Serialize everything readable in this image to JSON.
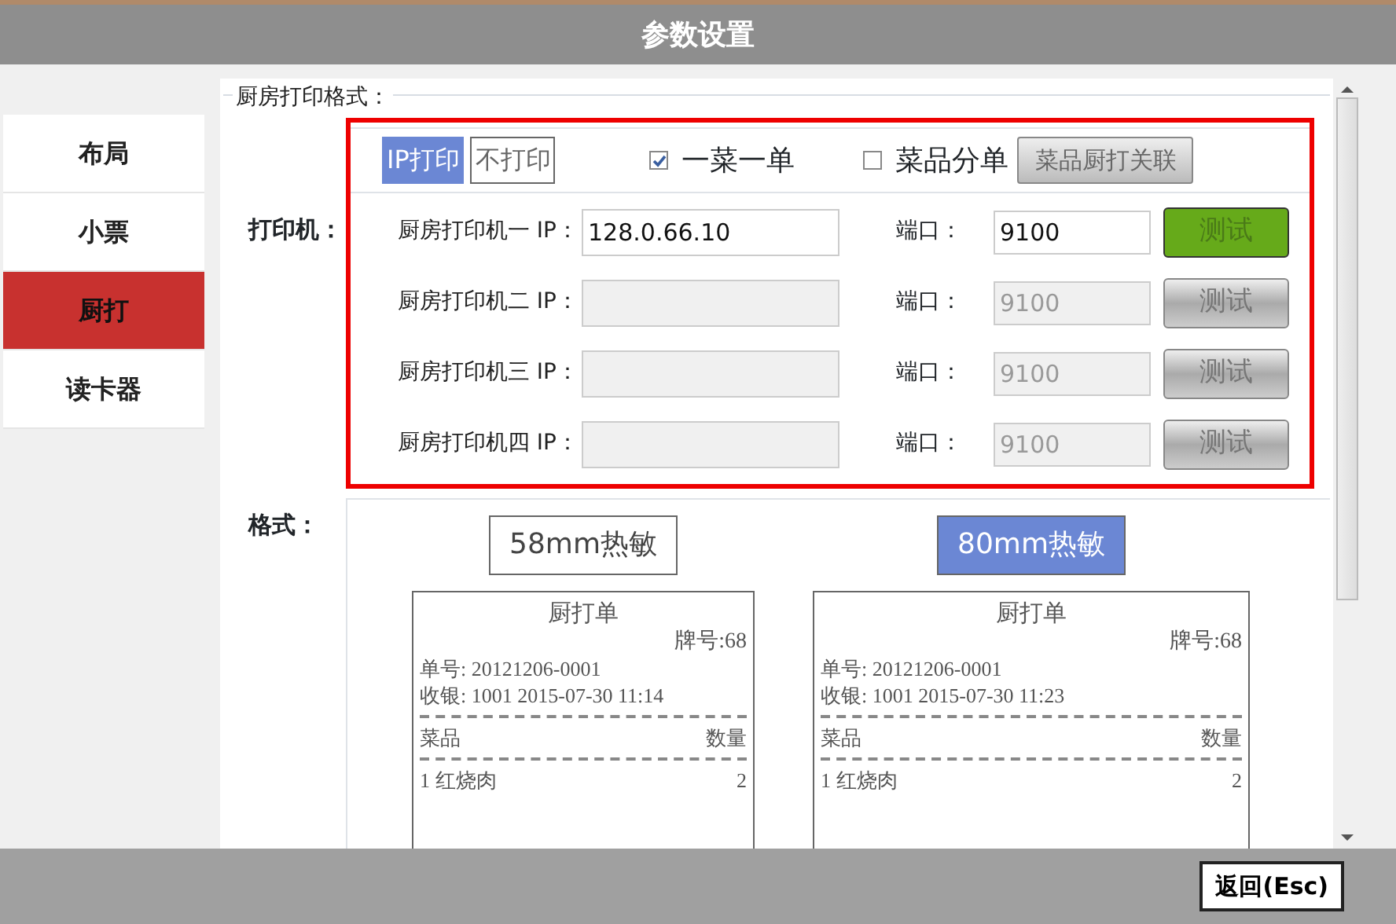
{
  "window": {
    "title": "参数设置"
  },
  "sidebar": {
    "items": [
      {
        "label": "布局",
        "selected": false
      },
      {
        "label": "小票",
        "selected": false
      },
      {
        "label": "厨打",
        "selected": true
      },
      {
        "label": "读卡器",
        "selected": false
      }
    ]
  },
  "section": {
    "legend": "厨房打印格式："
  },
  "printer": {
    "label": "打印机：",
    "modes": [
      {
        "label": "IP打印",
        "selected": true
      },
      {
        "label": "不打印",
        "selected": false
      }
    ],
    "options": [
      {
        "label": "一菜一单",
        "checked": true
      },
      {
        "label": "菜品分单",
        "checked": false
      }
    ],
    "mapping_button": "菜品厨打关联",
    "printers": [
      {
        "label": "厨房打印机一 IP：",
        "ip": "128.0.66.10",
        "port_label": "端口：",
        "port": "9100",
        "test_button": "测试",
        "enabled": true
      },
      {
        "label": "厨房打印机二 IP：",
        "port_label": "端口：",
        "port": "9100",
        "test_button": "测试",
        "enabled": false
      },
      {
        "label": "厨房打印机三 IP：",
        "port_label": "端口：",
        "port": "9100",
        "test_button": "测试",
        "enabled": false
      },
      {
        "label": "厨房打印机四 IP：",
        "port_label": "端口：",
        "port": "9100",
        "test_button": "测试",
        "enabled": false
      }
    ]
  },
  "format": {
    "label": "格式：",
    "options": [
      {
        "label": "58mm热敏",
        "selected": false,
        "receipt": {
          "title": "厨打单",
          "table_no": "牌号:68",
          "order_no": "单号: 20121206-0001",
          "cashier": "收银: 1001 2015-07-30 11:14",
          "col_item": "菜品",
          "col_qty": "数量",
          "lines": [
            {
              "item": "1  红烧肉",
              "qty": "2"
            }
          ]
        }
      },
      {
        "label": "80mm热敏",
        "selected": true,
        "receipt": {
          "title": "厨打单",
          "table_no": "牌号:68",
          "order_no": "单号: 20121206-0001",
          "cashier": "收银: 1001 2015-07-30 11:23",
          "col_item": "菜品",
          "col_qty": "数量",
          "lines": [
            {
              "item": "1  红烧肉",
              "qty": "2"
            }
          ]
        }
      }
    ]
  },
  "footer": {
    "back_button": "返回(Esc)"
  }
}
